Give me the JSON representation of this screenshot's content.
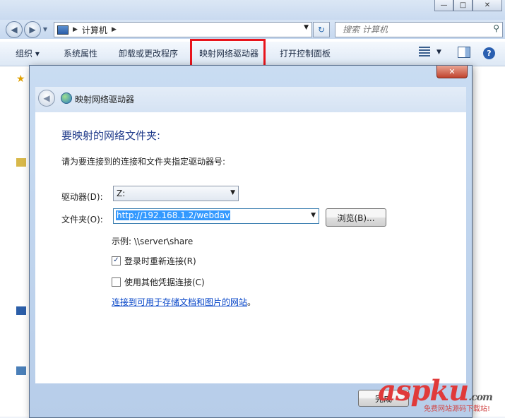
{
  "explorer": {
    "breadcrumb": "计算机",
    "search_placeholder": "搜索 计算机",
    "toolbar": {
      "organize": "组织",
      "system_properties": "系统属性",
      "uninstall": "卸载或更改程序",
      "map_drive": "映射网络驱动器",
      "control_panel": "打开控制面板"
    },
    "highlight_color": "#e8141c"
  },
  "dialog": {
    "title": "映射网络驱动器",
    "heading": "要映射的网络文件夹:",
    "instruction": "请为要连接到的连接和文件夹指定驱动器号:",
    "drive_label": "驱动器(D):",
    "drive_value": "Z:",
    "folder_label": "文件夹(O):",
    "folder_value": "http://192.168.1.2/webdav",
    "browse_label": "浏览(B)...",
    "example": "示例: \\\\server\\share",
    "reconnect_label": "登录时重新连接(R)",
    "reconnect_checked": true,
    "credentials_label": "使用其他凭据连接(C)",
    "credentials_checked": false,
    "link_text": "连接到可用于存储文档和图片的网站",
    "link_suffix": "。",
    "finish_label": "完成"
  },
  "watermark": {
    "text": "aspku",
    "suffix": ".com",
    "sub": "免费网站源码下载站!"
  }
}
